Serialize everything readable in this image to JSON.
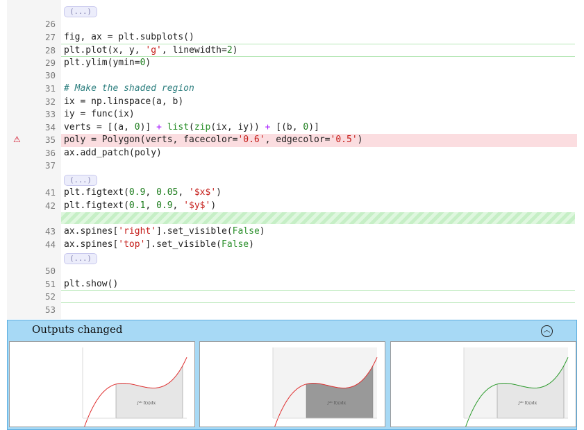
{
  "editor": {
    "collapsed_marker": "(...)",
    "lines": [
      {
        "n": "26",
        "code": []
      },
      {
        "n": "27",
        "code": [
          [
            "fig, ax = plt.subplots()",
            ""
          ]
        ]
      },
      {
        "n": "28",
        "code": [
          [
            "plt.plot(x, y, ",
            ""
          ],
          [
            "'g'",
            "str"
          ],
          [
            ", linewidth=",
            ""
          ],
          [
            "2",
            "num"
          ],
          [
            ")",
            ""
          ]
        ]
      },
      {
        "n": "29",
        "code": [
          [
            "plt.ylim(ymin=",
            ""
          ],
          [
            "0",
            "num"
          ],
          [
            ")",
            ""
          ]
        ]
      },
      {
        "n": "30",
        "code": []
      },
      {
        "n": "31",
        "code": [
          [
            "# Make the shaded region",
            "cmt"
          ]
        ]
      },
      {
        "n": "32",
        "code": [
          [
            "ix = np.linspace(a, b)",
            ""
          ]
        ]
      },
      {
        "n": "33",
        "code": [
          [
            "iy = func(ix)",
            ""
          ]
        ]
      },
      {
        "n": "34",
        "code": [
          [
            "verts = [(a, ",
            ""
          ],
          [
            "0",
            "num"
          ],
          [
            ")] ",
            ""
          ],
          [
            "+",
            "op"
          ],
          [
            " ",
            ""
          ],
          [
            "list",
            "kw"
          ],
          [
            "(",
            ""
          ],
          [
            "zip",
            "kw"
          ],
          [
            "(ix, iy)) ",
            ""
          ],
          [
            "+",
            "op"
          ],
          [
            " [(b, ",
            ""
          ],
          [
            "0",
            "num"
          ],
          [
            ")]",
            ""
          ]
        ]
      },
      {
        "n": "35",
        "code": [
          [
            "poly = Polygon(verts, facecolor=",
            ""
          ],
          [
            "'0.6'",
            "str"
          ],
          [
            ", edgecolor=",
            ""
          ],
          [
            "'0.5'",
            "str"
          ],
          [
            ")",
            ""
          ]
        ],
        "error": true
      },
      {
        "n": "36",
        "code": [
          [
            "ax.add_patch(poly)",
            ""
          ]
        ]
      },
      {
        "n": "37",
        "code": []
      },
      {
        "n": "41",
        "code": [
          [
            "plt.figtext(",
            ""
          ],
          [
            "0.9",
            "num"
          ],
          [
            ", ",
            ""
          ],
          [
            "0.05",
            "num"
          ],
          [
            ", ",
            ""
          ],
          [
            "'$x$'",
            "str"
          ],
          [
            ")",
            ""
          ]
        ]
      },
      {
        "n": "42",
        "code": [
          [
            "plt.figtext(",
            ""
          ],
          [
            "0.1",
            "num"
          ],
          [
            ", ",
            ""
          ],
          [
            "0.9",
            "num"
          ],
          [
            ", ",
            ""
          ],
          [
            "'$y$'",
            "str"
          ],
          [
            ")",
            ""
          ]
        ]
      },
      {
        "n": "43",
        "code": [
          [
            "ax.spines[",
            ""
          ],
          [
            "'right'",
            "str"
          ],
          [
            "].set_visible(",
            ""
          ],
          [
            "False",
            "kw"
          ],
          [
            ")",
            ""
          ]
        ]
      },
      {
        "n": "44",
        "code": [
          [
            "ax.spines[",
            ""
          ],
          [
            "'top'",
            "str"
          ],
          [
            "].set_visible(",
            ""
          ],
          [
            "False",
            "kw"
          ],
          [
            ")",
            ""
          ]
        ]
      },
      {
        "n": "50",
        "code": []
      },
      {
        "n": "51",
        "code": [
          [
            "plt.show()",
            ""
          ]
        ]
      },
      {
        "n": "52",
        "code": []
      },
      {
        "n": "53",
        "code": []
      }
    ]
  },
  "outputs": {
    "title": "Outputs changed",
    "toggle_icon": "chevron-up-circle-icon",
    "panels": [
      {
        "name": "output-base",
        "curve_color": "#e03030",
        "fill_color": "#e6e6e6",
        "background": "#ffffff",
        "annotation": "∫ᵃᵇ f(x)dx"
      },
      {
        "name": "output-local",
        "curve_color": "#e03030",
        "fill_color": "#999999",
        "background": "#f3f3f3",
        "annotation": "∫ᵃᵇ f(x)dx"
      },
      {
        "name": "output-remote",
        "curve_color": "#2a9a2a",
        "fill_color": "#e6e6e6",
        "background": "#f3f3f3",
        "annotation": "∫ᵃᵇ f(x)dx"
      }
    ]
  }
}
